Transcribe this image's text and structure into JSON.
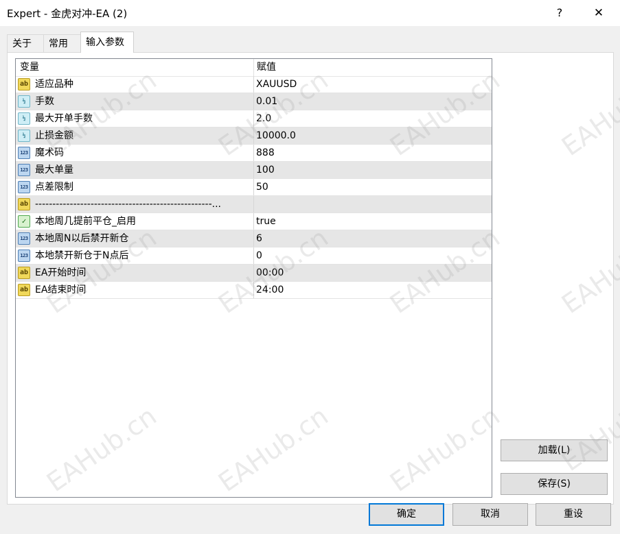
{
  "window": {
    "title": "Expert - 金虎对冲-EA (2)",
    "help_label": "?",
    "close_label": "✕"
  },
  "tabs": [
    {
      "label": "关于",
      "active": false
    },
    {
      "label": "常用",
      "active": false
    },
    {
      "label": "输入参数",
      "active": true
    }
  ],
  "grid": {
    "columns": [
      "变量",
      "赋值"
    ],
    "rows": [
      {
        "icon": "ab",
        "name": "适应品种",
        "value": "XAUUSD"
      },
      {
        "icon": "1/2",
        "name": "手数",
        "value": "0.01"
      },
      {
        "icon": "1/2",
        "name": "最大开单手数",
        "value": "2.0"
      },
      {
        "icon": "1/2",
        "name": "止损金额",
        "value": "10000.0"
      },
      {
        "icon": "123",
        "name": "魔术码",
        "value": "888"
      },
      {
        "icon": "123",
        "name": "最大单量",
        "value": "100"
      },
      {
        "icon": "123",
        "name": "点差限制",
        "value": "50"
      },
      {
        "icon": "ab",
        "name": "---------------------------------------------------...",
        "value": ""
      },
      {
        "icon": "bool",
        "name": "本地周几提前平仓_启用",
        "value": "true"
      },
      {
        "icon": "123",
        "name": "本地周N以后禁开新仓",
        "value": "6"
      },
      {
        "icon": "123",
        "name": "本地禁开新仓于N点后",
        "value": "0"
      },
      {
        "icon": "ab",
        "name": "EA开始时间",
        "value": "00:00"
      },
      {
        "icon": "ab",
        "name": "EA结束时间",
        "value": "24:00"
      }
    ]
  },
  "side_buttons": {
    "load_label": "加载(L)",
    "save_label": "保存(S)"
  },
  "footer_buttons": {
    "ok_label": "确定",
    "cancel_label": "取消",
    "reset_label": "重设"
  },
  "watermark_text": "EAHub.cn",
  "colors": {
    "accent": "#0078d7",
    "alt_row": "#e6e6e6",
    "icon_string": "#f0d85a",
    "icon_double": "#cfeef6",
    "icon_int": "#bcd6f0",
    "icon_bool": "#d8f2cf"
  }
}
